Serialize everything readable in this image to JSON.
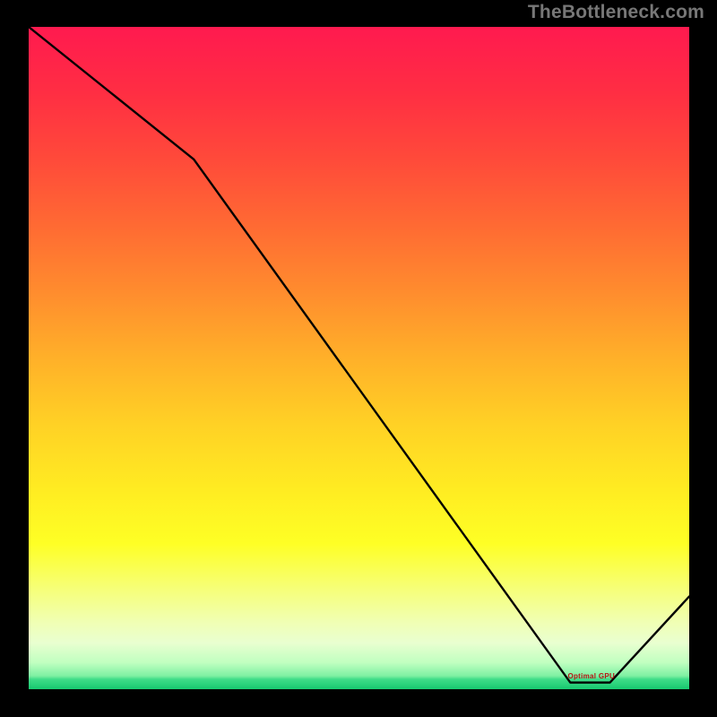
{
  "attribution": "TheBottleneck.com",
  "annotation_label": "Optimal GPU",
  "chart_data": {
    "type": "line",
    "title": "",
    "xlabel": "",
    "ylabel": "",
    "xlim": [
      0,
      100
    ],
    "ylim": [
      0,
      100
    ],
    "grid": false,
    "legend": false,
    "series": [
      {
        "name": "bottleneck-curve",
        "x": [
          0,
          25,
          82,
          88,
          100
        ],
        "values": [
          100,
          80,
          1,
          1,
          14
        ]
      }
    ],
    "optimal_x_range": [
      82,
      88
    ],
    "gradient_stops": [
      {
        "offset": 0.0,
        "color": "#ff1a4f"
      },
      {
        "offset": 0.1,
        "color": "#ff2e43"
      },
      {
        "offset": 0.2,
        "color": "#ff4a3a"
      },
      {
        "offset": 0.3,
        "color": "#ff6a33"
      },
      {
        "offset": 0.4,
        "color": "#ff8c2e"
      },
      {
        "offset": 0.5,
        "color": "#ffb029"
      },
      {
        "offset": 0.6,
        "color": "#ffd125"
      },
      {
        "offset": 0.7,
        "color": "#ffec22"
      },
      {
        "offset": 0.78,
        "color": "#feff25"
      },
      {
        "offset": 0.85,
        "color": "#f6ff7a"
      },
      {
        "offset": 0.9,
        "color": "#f0ffb5"
      },
      {
        "offset": 0.93,
        "color": "#e9ffd0"
      },
      {
        "offset": 0.96,
        "color": "#c0ffc0"
      },
      {
        "offset": 0.98,
        "color": "#7ef0a2"
      },
      {
        "offset": 0.985,
        "color": "#3fdc88"
      },
      {
        "offset": 1.0,
        "color": "#17c86f"
      }
    ]
  }
}
